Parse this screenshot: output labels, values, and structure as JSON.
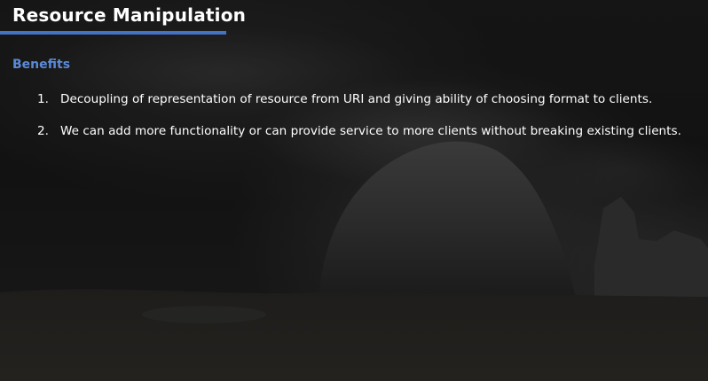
{
  "slide": {
    "title": "Resource Manipulation",
    "subtitle": "Benefits",
    "items": [
      {
        "number": "1.",
        "text": "Decoupling of representation of resource from URI and giving ability of choosing format to clients."
      },
      {
        "number": "2.",
        "text": "We can add more functionality or can provide service to more clients without breaking existing clients."
      }
    ]
  },
  "colors": {
    "accent": "#4472c4",
    "subtitle": "#5b8ad8",
    "text": "#ffffff",
    "background": "#121212"
  }
}
